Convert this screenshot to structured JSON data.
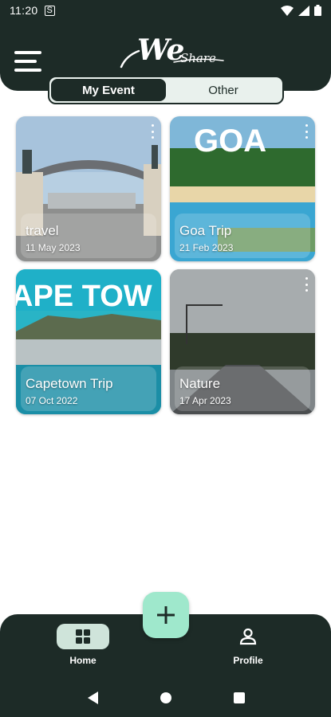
{
  "status": {
    "time": "11:20",
    "sim_label": "S"
  },
  "app": {
    "logo_main": "We",
    "logo_sub": "Share"
  },
  "tabs": {
    "my_event": "My Event",
    "other": "Other"
  },
  "events": [
    {
      "title": "travel",
      "date": "11 May 2023",
      "image": "gate-arch-photo"
    },
    {
      "title": "Goa Trip",
      "date": "21 Feb 2023",
      "image": "goa-beach-photo",
      "image_text": "GOA"
    },
    {
      "title": "Capetown Trip",
      "date": "07 Oct 2022",
      "image": "capetown-coast-photo",
      "image_text": "APE TOW"
    },
    {
      "title": "Nature",
      "date": "17 Apr 2023",
      "image": "road-cloudy-sky-photo"
    }
  ],
  "bottom_nav": {
    "home": "Home",
    "profile": "Profile"
  },
  "colors": {
    "primary_dark": "#1d2b27",
    "accent": "#9fe8cc",
    "tab_bg": "#e9f1ed",
    "home_pill": "#cfe4da"
  }
}
